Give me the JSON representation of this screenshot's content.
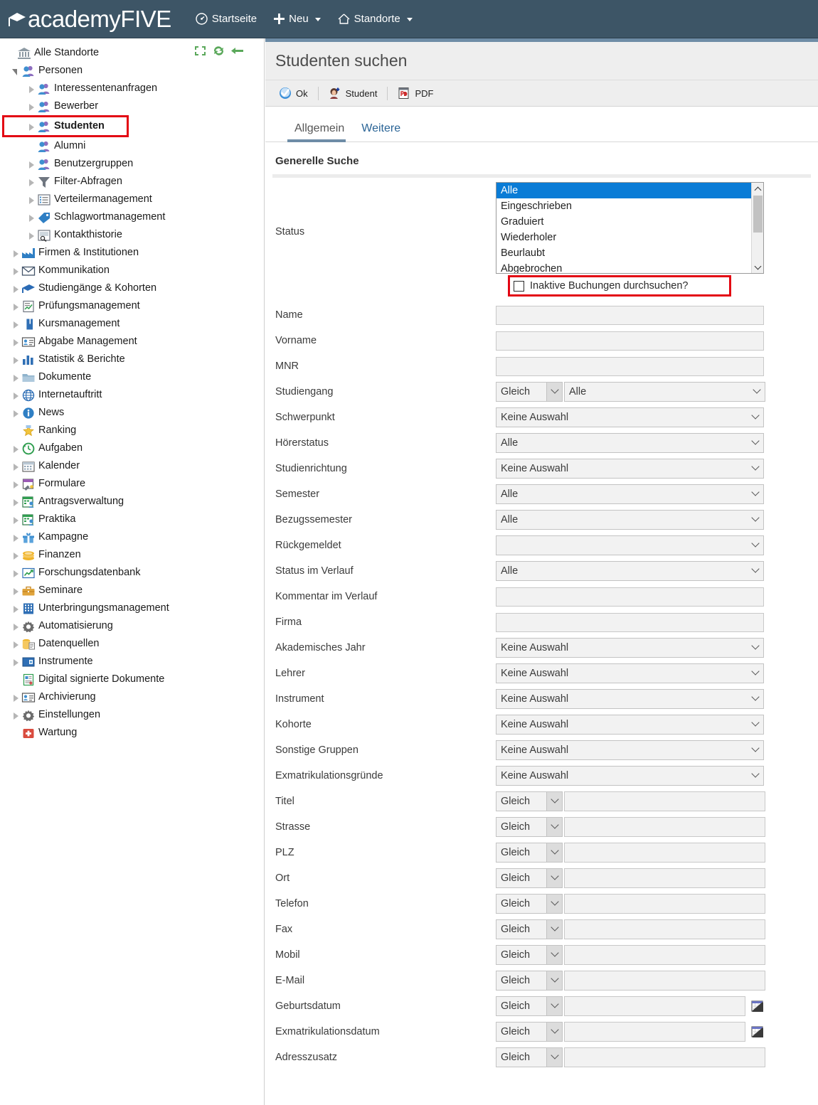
{
  "topnav": {
    "brand_academy": "academy",
    "brand_five": "FIVE",
    "items": [
      {
        "label": "Startseite",
        "icon": "dashboard-icon",
        "caret": false
      },
      {
        "label": "Neu",
        "icon": "plus-icon",
        "caret": true
      },
      {
        "label": "Standorte",
        "icon": "home-icon",
        "caret": true
      }
    ]
  },
  "sidebar": {
    "root": {
      "label": "Alle Standorte",
      "icon": "bank-icon"
    },
    "tools": [
      {
        "name": "collapse-all-icon",
        "title": "Alle zuklappen"
      },
      {
        "name": "refresh-icon",
        "title": "Aktualisieren"
      },
      {
        "name": "back-icon",
        "title": "Zurück"
      }
    ],
    "items": [
      {
        "label": "Personen",
        "level": 1,
        "arrow": "expanded",
        "icon": "people-icon",
        "bold": false,
        "highlight": false
      },
      {
        "label": "Interessentenanfragen",
        "level": 2,
        "arrow": "collapsed",
        "icon": "people-icon",
        "bold": false,
        "highlight": false
      },
      {
        "label": "Bewerber",
        "level": 2,
        "arrow": "collapsed",
        "icon": "people-icon",
        "bold": false,
        "highlight": false
      },
      {
        "label": "Studenten",
        "level": 2,
        "arrow": "collapsed",
        "icon": "people-icon",
        "bold": true,
        "highlight": true
      },
      {
        "label": "Alumni",
        "level": 2,
        "arrow": "none",
        "icon": "people-icon",
        "bold": false,
        "highlight": false
      },
      {
        "label": "Benutzergruppen",
        "level": 2,
        "arrow": "collapsed",
        "icon": "people-icon",
        "bold": false,
        "highlight": false
      },
      {
        "label": "Filter-Abfragen",
        "level": 2,
        "arrow": "collapsed",
        "icon": "funnel-icon",
        "bold": false,
        "highlight": false
      },
      {
        "label": "Verteilermanagement",
        "level": 2,
        "arrow": "collapsed",
        "icon": "list-icon",
        "bold": false,
        "highlight": false
      },
      {
        "label": "Schlagwortmanagement",
        "level": 2,
        "arrow": "collapsed",
        "icon": "tag-icon",
        "bold": false,
        "highlight": false
      },
      {
        "label": "Kontakthistorie",
        "level": 2,
        "arrow": "collapsed",
        "icon": "contact-history-icon",
        "bold": false,
        "highlight": false
      },
      {
        "label": "Firmen & Institutionen",
        "level": 1,
        "arrow": "collapsed",
        "icon": "factory-icon",
        "bold": false,
        "highlight": false
      },
      {
        "label": "Kommunikation",
        "level": 1,
        "arrow": "collapsed",
        "icon": "envelope-icon",
        "bold": false,
        "highlight": false
      },
      {
        "label": "Studiengänge & Kohorten",
        "level": 1,
        "arrow": "collapsed",
        "icon": "graduation-cap-icon",
        "bold": false,
        "highlight": false
      },
      {
        "label": "Prüfungsmanagement",
        "level": 1,
        "arrow": "collapsed",
        "icon": "exam-icon",
        "bold": false,
        "highlight": false
      },
      {
        "label": "Kursmanagement",
        "level": 1,
        "arrow": "collapsed",
        "icon": "book-icon",
        "bold": false,
        "highlight": false
      },
      {
        "label": "Abgabe Management",
        "level": 1,
        "arrow": "collapsed",
        "icon": "id-card-icon",
        "bold": false,
        "highlight": false
      },
      {
        "label": "Statistik & Berichte",
        "level": 1,
        "arrow": "collapsed",
        "icon": "bar-chart-icon",
        "bold": false,
        "highlight": false
      },
      {
        "label": "Dokumente",
        "level": 1,
        "arrow": "collapsed",
        "icon": "folder-icon",
        "bold": false,
        "highlight": false
      },
      {
        "label": "Internetauftritt",
        "level": 1,
        "arrow": "collapsed",
        "icon": "globe-icon",
        "bold": false,
        "highlight": false
      },
      {
        "label": "News",
        "level": 1,
        "arrow": "collapsed",
        "icon": "info-icon",
        "bold": false,
        "highlight": false
      },
      {
        "label": "Ranking",
        "level": 1,
        "arrow": "none",
        "icon": "star-medal-icon",
        "bold": false,
        "highlight": false
      },
      {
        "label": "Aufgaben",
        "level": 1,
        "arrow": "collapsed",
        "icon": "clock-icon",
        "bold": false,
        "highlight": false
      },
      {
        "label": "Kalender",
        "level": 1,
        "arrow": "collapsed",
        "icon": "calendar-icon",
        "bold": false,
        "highlight": false
      },
      {
        "label": "Formulare",
        "level": 1,
        "arrow": "collapsed",
        "icon": "form-icon",
        "bold": false,
        "highlight": false
      },
      {
        "label": "Antragsverwaltung",
        "level": 1,
        "arrow": "collapsed",
        "icon": "application-icon",
        "bold": false,
        "highlight": false
      },
      {
        "label": "Praktika",
        "level": 1,
        "arrow": "collapsed",
        "icon": "application-icon",
        "bold": false,
        "highlight": false
      },
      {
        "label": "Kampagne",
        "level": 1,
        "arrow": "collapsed",
        "icon": "gift-icon",
        "bold": false,
        "highlight": false
      },
      {
        "label": "Finanzen",
        "level": 1,
        "arrow": "collapsed",
        "icon": "coins-icon",
        "bold": false,
        "highlight": false
      },
      {
        "label": "Forschungsdatenbank",
        "level": 1,
        "arrow": "collapsed",
        "icon": "chart-up-icon",
        "bold": false,
        "highlight": false
      },
      {
        "label": "Seminare",
        "level": 1,
        "arrow": "collapsed",
        "icon": "briefcase-icon",
        "bold": false,
        "highlight": false
      },
      {
        "label": "Unterbringungsmanagement",
        "level": 1,
        "arrow": "collapsed",
        "icon": "building-icon",
        "bold": false,
        "highlight": false
      },
      {
        "label": "Automatisierung",
        "level": 1,
        "arrow": "collapsed",
        "icon": "gear-icon",
        "bold": false,
        "highlight": false
      },
      {
        "label": "Datenquellen",
        "level": 1,
        "arrow": "collapsed",
        "icon": "database-icon",
        "bold": false,
        "highlight": false
      },
      {
        "label": "Instrumente",
        "level": 1,
        "arrow": "collapsed",
        "icon": "instrument-icon",
        "bold": false,
        "highlight": false
      },
      {
        "label": "Digital signierte Dokumente",
        "level": 1,
        "arrow": "none",
        "icon": "signed-doc-icon",
        "bold": false,
        "highlight": false
      },
      {
        "label": "Archivierung",
        "level": 1,
        "arrow": "collapsed",
        "icon": "id-card-icon",
        "bold": false,
        "highlight": false
      },
      {
        "label": "Einstellungen",
        "level": 1,
        "arrow": "collapsed",
        "icon": "gear-icon",
        "bold": false,
        "highlight": false
      },
      {
        "label": "Wartung",
        "level": 1,
        "arrow": "none",
        "icon": "first-aid-icon",
        "bold": false,
        "highlight": false
      }
    ]
  },
  "main": {
    "page_title": "Studenten suchen",
    "toolbar": [
      {
        "label": "Ok",
        "icon": "ok-check-icon"
      },
      {
        "label": "Student",
        "icon": "add-student-icon"
      },
      {
        "label": "PDF",
        "icon": "pdf-icon"
      }
    ],
    "tabs": [
      {
        "label": "Allgemein",
        "active": true
      },
      {
        "label": "Weitere",
        "active": false
      }
    ],
    "section_title": "Generelle Suche",
    "status": {
      "label": "Status",
      "options": [
        "Alle",
        "Eingeschrieben",
        "Graduiert",
        "Wiederholer",
        "Beurlaubt",
        "Abgebrochen"
      ],
      "selected": "Alle",
      "checkbox_label": "Inaktive Buchungen durchsuchen?",
      "checkbox_checked": false
    },
    "fields": [
      {
        "label": "Name",
        "type": "text",
        "value": ""
      },
      {
        "label": "Vorname",
        "type": "text",
        "value": ""
      },
      {
        "label": "MNR",
        "type": "text",
        "value": ""
      },
      {
        "label": "Studiengang",
        "type": "op-select",
        "op": "Gleich",
        "value": "Alle"
      },
      {
        "label": "Schwerpunkt",
        "type": "select",
        "value": "Keine Auswahl"
      },
      {
        "label": "Hörerstatus",
        "type": "select",
        "value": "Alle"
      },
      {
        "label": "Studienrichtung",
        "type": "select",
        "value": "Keine Auswahl"
      },
      {
        "label": "Semester",
        "type": "select",
        "value": "Alle"
      },
      {
        "label": "Bezugssemester",
        "type": "select",
        "value": "Alle"
      },
      {
        "label": "Rückgemeldet",
        "type": "select",
        "value": ""
      },
      {
        "label": "Status im Verlauf",
        "type": "select",
        "value": "Alle"
      },
      {
        "label": "Kommentar im Verlauf",
        "type": "text",
        "value": ""
      },
      {
        "label": "Firma",
        "type": "text",
        "value": ""
      },
      {
        "label": "Akademisches Jahr",
        "type": "select",
        "value": "Keine Auswahl"
      },
      {
        "label": "Lehrer",
        "type": "select",
        "value": "Keine Auswahl"
      },
      {
        "label": "Instrument",
        "type": "select",
        "value": "Keine Auswahl"
      },
      {
        "label": "Kohorte",
        "type": "select",
        "value": "Keine Auswahl"
      },
      {
        "label": "Sonstige Gruppen",
        "type": "select",
        "value": "Keine Auswahl"
      },
      {
        "label": "Exmatrikulationsgründe",
        "type": "select",
        "value": "Keine Auswahl"
      },
      {
        "label": "Titel",
        "type": "op-text",
        "op": "Gleich",
        "value": ""
      },
      {
        "label": "Strasse",
        "type": "op-text",
        "op": "Gleich",
        "value": ""
      },
      {
        "label": "PLZ",
        "type": "op-text",
        "op": "Gleich",
        "value": ""
      },
      {
        "label": "Ort",
        "type": "op-text",
        "op": "Gleich",
        "value": ""
      },
      {
        "label": "Telefon",
        "type": "op-text",
        "op": "Gleich",
        "value": ""
      },
      {
        "label": "Fax",
        "type": "op-text",
        "op": "Gleich",
        "value": ""
      },
      {
        "label": "Mobil",
        "type": "op-text",
        "op": "Gleich",
        "value": ""
      },
      {
        "label": "E-Mail",
        "type": "op-text",
        "op": "Gleich",
        "value": ""
      },
      {
        "label": "Geburtsdatum",
        "type": "op-date",
        "op": "Gleich",
        "value": ""
      },
      {
        "label": "Exmatrikulationsdatum",
        "type": "op-date",
        "op": "Gleich",
        "value": ""
      },
      {
        "label": "Adresszusatz",
        "type": "op-text",
        "op": "Gleich",
        "value": ""
      }
    ]
  },
  "colors": {
    "topnav_bg": "#3d5566",
    "accent_blue": "#6e8ca6",
    "highlight_red": "#e30613",
    "listbox_selected": "#0a7cd6",
    "link_blue": "#2a6496"
  }
}
